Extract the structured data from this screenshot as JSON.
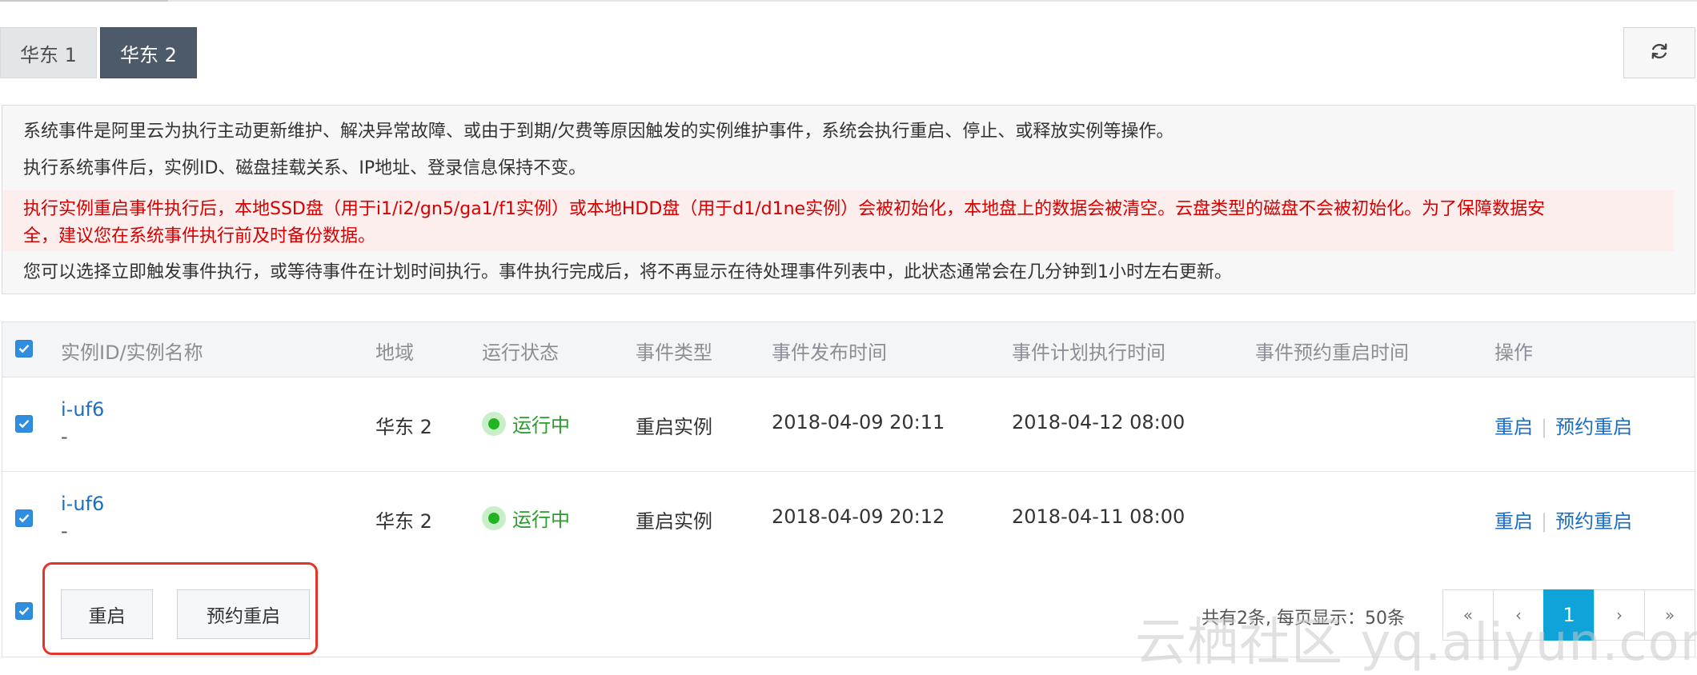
{
  "tabs": [
    {
      "label": "华东 1"
    },
    {
      "label": "华东 2"
    }
  ],
  "notice": {
    "line1": "系统事件是阿里云为执行主动更新维护、解决异常故障、或由于到期/欠费等原因触发的实例维护事件，系统会执行重启、停止、或释放实例等操作。",
    "line2": "执行系统事件后，实例ID、磁盘挂载关系、IP地址、登录信息保持不变。",
    "warning_line1": "执行实例重启事件执行后，本地SSD盘（用于i1/i2/gn5/ga1/f1实例）或本地HDD盘（用于d1/d1ne实例）会被初始化，本地盘上的数据会被清空。云盘类型的磁盘不会被初始化。为了保障数据安",
    "warning_line2": "全，建议您在系统事件执行前及时备份数据。",
    "line4": "您可以选择立即触发事件执行，或等待事件在计划时间执行。事件执行完成后，将不再显示在待处理事件列表中，此状态通常会在几分钟到1小时左右更新。",
    "warning_color": "#d40000"
  },
  "table": {
    "headers": {
      "instance": "实例ID/实例名称",
      "region": "地域",
      "status": "运行状态",
      "event_type": "事件类型",
      "publish_time": "事件发布时间",
      "plan_time": "事件计划执行时间",
      "reserve_time": "事件预约重启时间",
      "actions": "操作"
    },
    "rows": [
      {
        "instance_id": "i-uf6",
        "instance_name": "-",
        "region": "华东 2",
        "status": "运行中",
        "event_type": "重启实例",
        "publish_time": "2018-04-09 20:11",
        "plan_time": "2018-04-12 08:00",
        "reserve_time": "",
        "action_restart": "重启",
        "action_separator": "|",
        "action_reserve": "预约重启"
      },
      {
        "instance_id": "i-uf6",
        "instance_name": "-",
        "region": "华东 2",
        "status": "运行中",
        "event_type": "重启实例",
        "publish_time": "2018-04-09 20:12",
        "plan_time": "2018-04-11 08:00",
        "reserve_time": "",
        "action_restart": "重启",
        "action_separator": "|",
        "action_reserve": "预约重启"
      }
    ]
  },
  "footer": {
    "restart_button": "重启",
    "reserve_button": "预约重启",
    "page_info": "共有2条, 每页显示：50条",
    "pager": {
      "first": "«",
      "prev": "‹",
      "current": "1",
      "next": "›",
      "last": "»"
    }
  },
  "watermark": "云栖社区 yq.aliyun.com",
  "colors": {
    "active_tab": "#4d5a69",
    "link": "#1a6fc4",
    "running": "#2a9d2a",
    "checkbox": "#2f8ee0",
    "current_page": "#0ea3d9",
    "highlight": "#e4352a"
  },
  "icons": {
    "refresh": "refresh-icon",
    "checkbox": "checkmark-icon",
    "status": "running-dot-icon"
  }
}
